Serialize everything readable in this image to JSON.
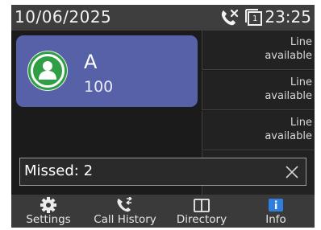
{
  "status_bar": {
    "date": "10/06/2025",
    "time": "23:25",
    "icons": [
      "missed-call-icon",
      "line-1-icon"
    ],
    "line_indicator": "1"
  },
  "contact_card": {
    "name": "A",
    "number": "100",
    "status_color": "#2f9e44",
    "card_color": "#5661a8"
  },
  "line_keys": [
    {
      "label": "Line\navailable"
    },
    {
      "label": "Line\navailable"
    },
    {
      "label": "Line\navailable"
    }
  ],
  "notification": {
    "text": "Missed: 2"
  },
  "softkeys": [
    {
      "label": "Settings",
      "icon": "gear-icon"
    },
    {
      "label": "Call History",
      "icon": "call-history-icon"
    },
    {
      "label": "Directory",
      "icon": "book-icon"
    },
    {
      "label": "Info",
      "icon": "info-icon",
      "accent": "#2f7fe0"
    }
  ]
}
